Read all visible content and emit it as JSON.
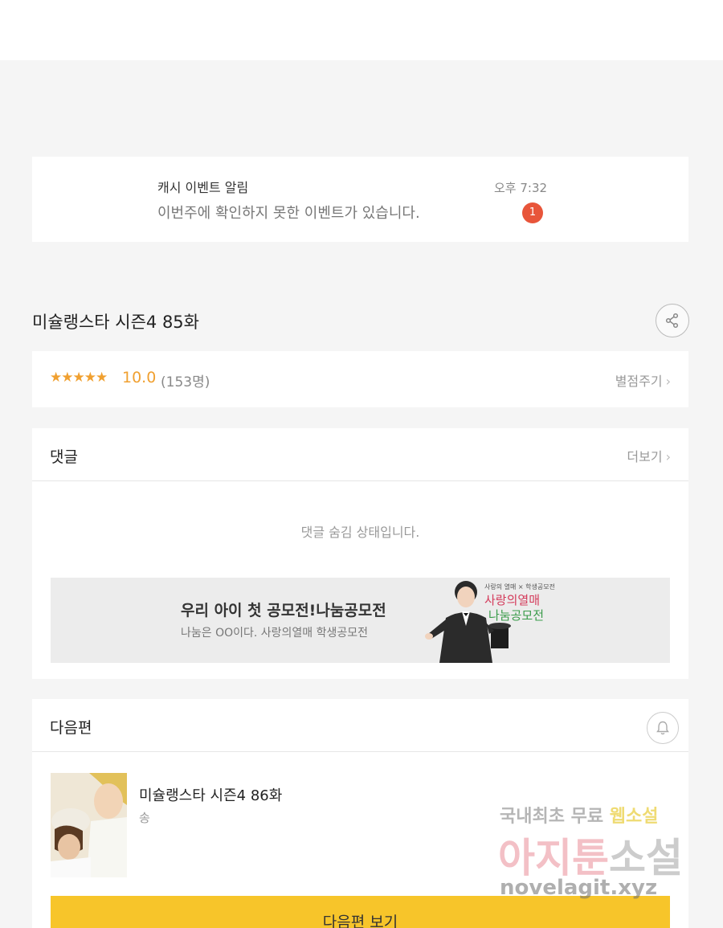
{
  "notification": {
    "title": "캐시 이벤트 알림",
    "body": "이번주에 확인하지 못한 이벤트가 있습니다.",
    "time": "오후 7:32",
    "badge": "1"
  },
  "episode": {
    "title": "미슐랭스타 시즌4 85화"
  },
  "rating": {
    "stars": "★★★★★",
    "score": "10.0",
    "count": "(153명)",
    "rate_link": "별점주기"
  },
  "comments": {
    "header": "댓글",
    "more": "더보기",
    "hidden_message": "댓글 숨김 상태입니다."
  },
  "banner": {
    "title": "우리 아이 첫 공모전!나눔공모전",
    "subtitle": "나눔은 OO이다. 사랑의열매 학생공모전",
    "small_text": "사랑의 열매 × 학생공모전",
    "logo_line1": "사랑의열매",
    "logo_line2": "나눔공모전"
  },
  "next_episode": {
    "header": "다음편",
    "title": "미슐랭스타 시즌4 86화",
    "author": "송",
    "button": "다음편 보기"
  },
  "watermark": {
    "line1_a": "국내최초 무료 ",
    "line1_b": "웹소설",
    "line2_a": "아지툰",
    "line2_b": "소설",
    "line3": "novelagit.xyz"
  },
  "icons": {
    "share": "share-icon",
    "bell": "bell-icon",
    "chevron": "chevron-right-icon"
  }
}
